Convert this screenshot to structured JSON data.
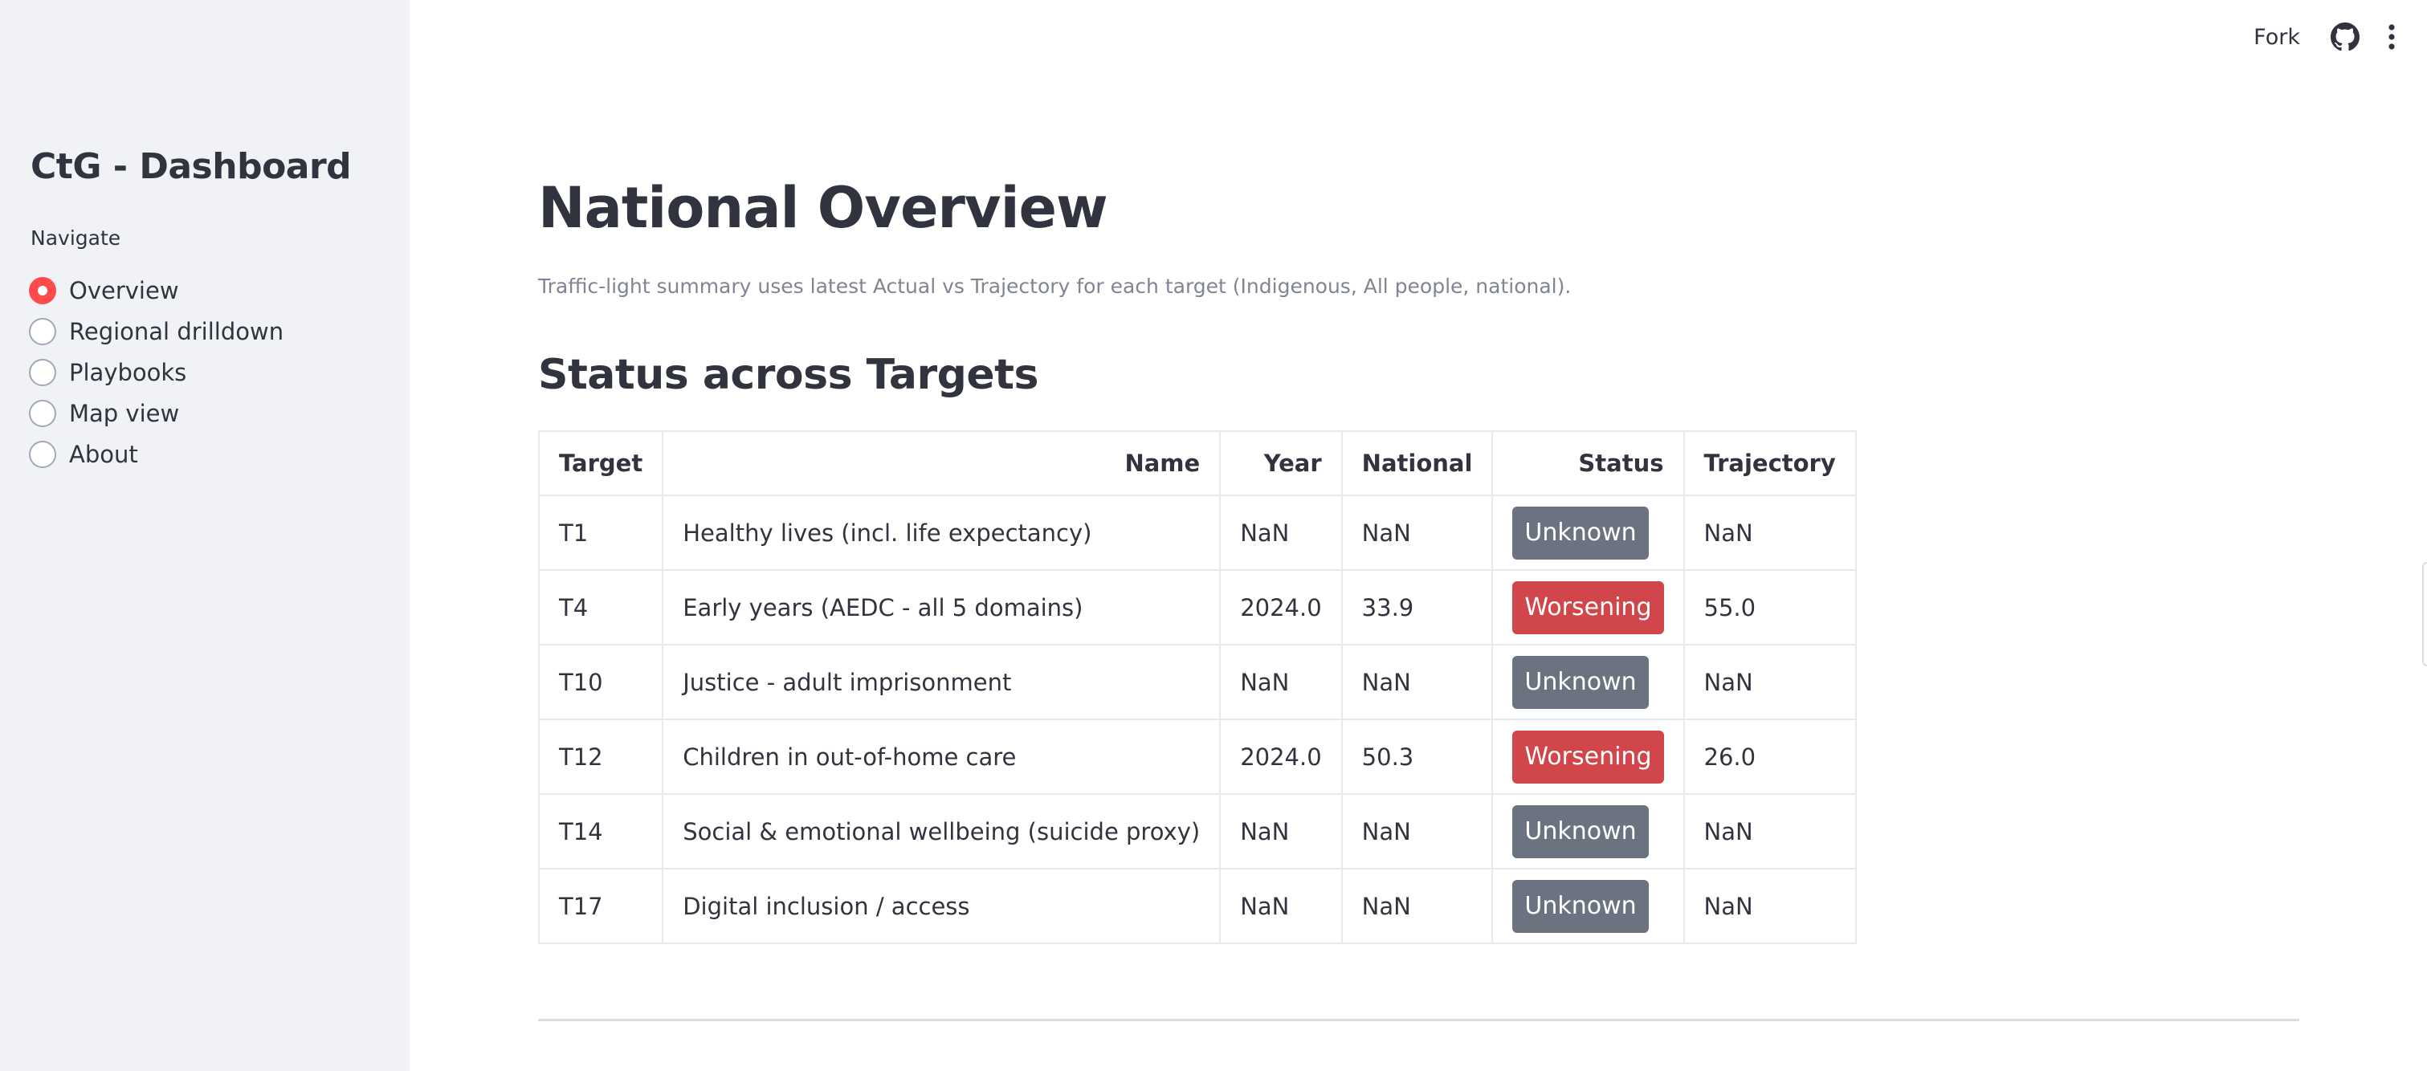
{
  "sidebar": {
    "title": "CtG - Dashboard",
    "nav_label": "Navigate",
    "items": [
      {
        "label": "Overview",
        "selected": true
      },
      {
        "label": "Regional drilldown",
        "selected": false
      },
      {
        "label": "Playbooks",
        "selected": false
      },
      {
        "label": "Map view",
        "selected": false
      },
      {
        "label": "About",
        "selected": false
      }
    ]
  },
  "header": {
    "fork_label": "Fork",
    "github_icon": "github-icon",
    "menu_icon": "more-vertical-icon"
  },
  "main": {
    "title": "National Overview",
    "caption": "Traffic-light summary uses latest Actual vs Trajectory for each target (Indigenous, All people, national).",
    "section_title": "Status across Targets",
    "table": {
      "headers": [
        "Target",
        "Name",
        "Year",
        "National",
        "Status",
        "Trajectory"
      ],
      "rows": [
        {
          "target": "T1",
          "name": "Healthy lives (incl. life expectancy)",
          "year": "NaN",
          "national": "NaN",
          "status": "Unknown",
          "trajectory": "NaN"
        },
        {
          "target": "T4",
          "name": "Early years (AEDC - all 5 domains)",
          "year": "2024.0",
          "national": "33.9",
          "status": "Worsening",
          "trajectory": "55.0"
        },
        {
          "target": "T10",
          "name": "Justice - adult imprisonment",
          "year": "NaN",
          "national": "NaN",
          "status": "Unknown",
          "trajectory": "NaN"
        },
        {
          "target": "T12",
          "name": "Children in out-of-home care",
          "year": "2024.0",
          "national": "50.3",
          "status": "Worsening",
          "trajectory": "26.0"
        },
        {
          "target": "T14",
          "name": "Social & emotional wellbeing (suicide proxy)",
          "year": "NaN",
          "national": "NaN",
          "status": "Unknown",
          "trajectory": "NaN"
        },
        {
          "target": "T17",
          "name": "Digital inclusion / access",
          "year": "NaN",
          "national": "NaN",
          "status": "Unknown",
          "trajectory": "NaN"
        }
      ]
    }
  },
  "colors": {
    "accent": "#ff4b4b",
    "status_unknown": "#6b7280",
    "status_worsening": "#d0464a",
    "sidebar_bg": "#f0f2f6"
  }
}
